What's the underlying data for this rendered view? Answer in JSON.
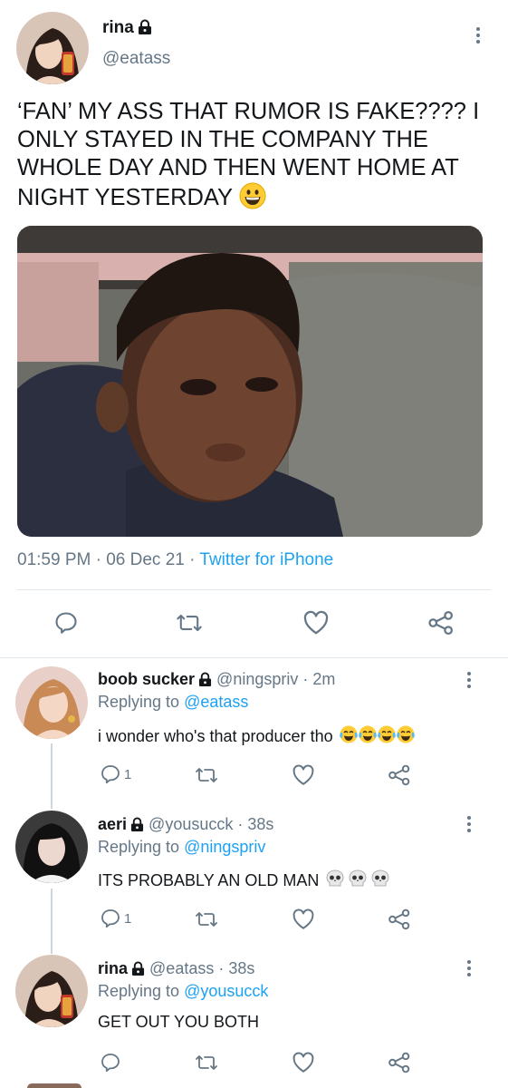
{
  "main_tweet": {
    "name": "rina",
    "handle": "@eatass",
    "text": "‘FAN’ MY ASS THAT RUMOR IS FAKE???? I ONLY STAYED IN THE COMPANY THE WHOLE DAY AND THEN WENT HOME AT NIGHT YESTERDAY",
    "time": "01:59 PM",
    "date": "06 Dec 21",
    "source": "Twitter for iPhone",
    "sep": "·",
    "icons": [
      "lock-icon",
      "grinning-face-emoji",
      "reply-icon",
      "retweet-icon",
      "like-icon",
      "share-icon",
      "more-icon"
    ]
  },
  "replies": [
    {
      "name": "boob sucker",
      "handle": "@ningspriv",
      "time": "2m",
      "replying_label": "Replying to",
      "replying_to": "@eatass",
      "text": "i wonder who's that producer tho",
      "emoji": [
        "tears-of-joy-emoji",
        "tears-of-joy-emoji",
        "tears-of-joy-emoji",
        "tears-of-joy-emoji"
      ],
      "reply_count": "1"
    },
    {
      "name": "aeri",
      "handle": "@yousucck",
      "time": "38s",
      "replying_label": "Replying to",
      "replying_to": "@ningspriv",
      "text": "ITS PROBABLY AN OLD MAN",
      "emoji": [
        "skull-emoji",
        "skull-emoji",
        "skull-emoji"
      ],
      "reply_count": "1"
    },
    {
      "name": "rina",
      "handle": "@eatass",
      "time": "38s",
      "replying_label": "Replying to",
      "replying_to": "@yousucck",
      "text": "GET OUT YOU BOTH",
      "emoji": [],
      "reply_count": ""
    }
  ],
  "colors": {
    "accent": "#1da1f2",
    "muted": "#657786",
    "text": "#14171a",
    "divider": "#e1e8ed"
  }
}
